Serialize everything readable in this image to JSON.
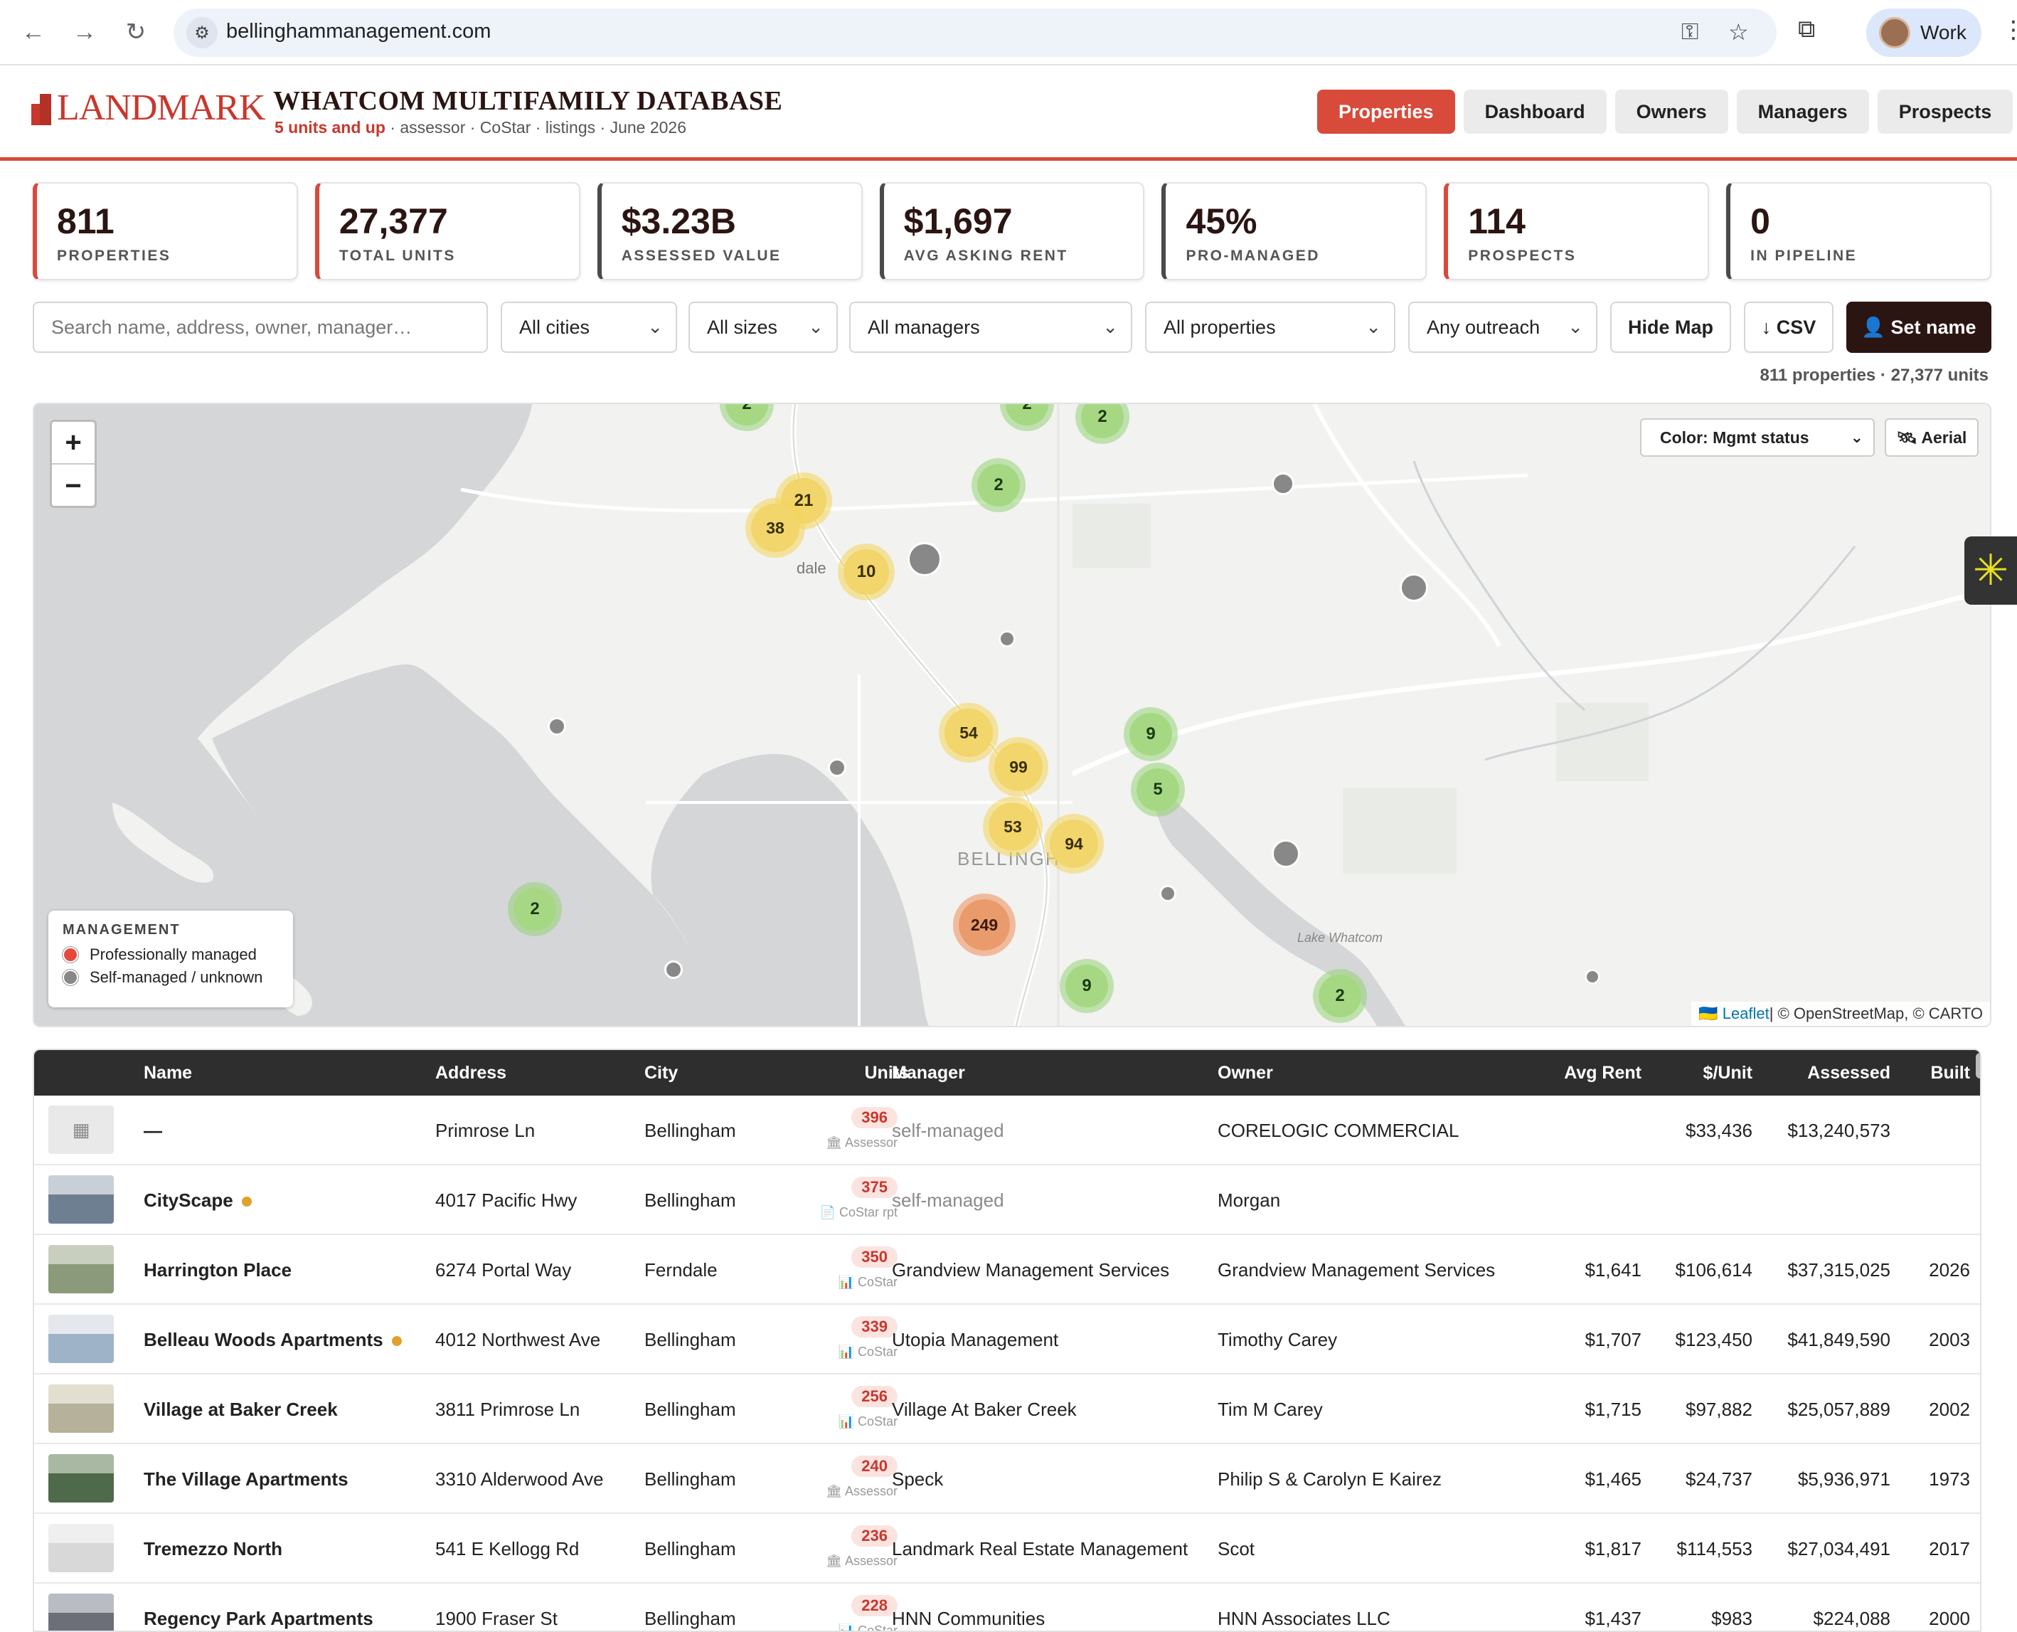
{
  "browser": {
    "url": "bellinghammanagement.com",
    "profile_label": "Work",
    "back_icon": "←",
    "forward_icon": "→",
    "reload_icon": "↻"
  },
  "header": {
    "logo_text": "LANDMARK",
    "title": "WHATCOM MULTIFAMILY DATABASE",
    "subtitle_accent": "5 units and up",
    "subtitle_rest": " · assessor · CoStar · listings · June 2026",
    "tabs": [
      "Properties",
      "Dashboard",
      "Owners",
      "Managers",
      "Prospects"
    ],
    "active_tab": "Properties"
  },
  "stats": [
    {
      "value": "811",
      "label": "PROPERTIES"
    },
    {
      "value": "27,377",
      "label": "TOTAL UNITS"
    },
    {
      "value": "$3.23B",
      "label": "ASSESSED VALUE"
    },
    {
      "value": "$1,697",
      "label": "AVG ASKING RENT"
    },
    {
      "value": "45%",
      "label": "PRO-MANAGED"
    },
    {
      "value": "114",
      "label": "PROSPECTS"
    },
    {
      "value": "0",
      "label": "IN PIPELINE"
    }
  ],
  "filters": {
    "search_placeholder": "Search name, address, owner, manager…",
    "city": "All cities",
    "size": "All sizes",
    "manager": "All managers",
    "properties": "All properties",
    "outreach": "Any outreach",
    "hide_map": "Hide Map",
    "csv": "↓ CSV",
    "set_name": "👤 Set name"
  },
  "count_line": "811 properties · 27,377 units",
  "map": {
    "zoom_in": "+",
    "zoom_out": "−",
    "color_select": "Color: Mgmt status",
    "aerial_label": "🛰 Aerial",
    "place_labels": [
      "dale",
      "BELLINGH",
      "Lake Whatcom"
    ],
    "clusters": [
      {
        "count": "2",
        "color": "green"
      },
      {
        "count": "2",
        "color": "green"
      },
      {
        "count": "2",
        "color": "green"
      },
      {
        "count": "2",
        "color": "green"
      },
      {
        "count": "21",
        "color": "yellow"
      },
      {
        "count": "38",
        "color": "yellow"
      },
      {
        "count": "10",
        "color": "yellow"
      },
      {
        "count": "54",
        "color": "yellow"
      },
      {
        "count": "99",
        "color": "yellow"
      },
      {
        "count": "9",
        "color": "green"
      },
      {
        "count": "5",
        "color": "green"
      },
      {
        "count": "53",
        "color": "yellow"
      },
      {
        "count": "94",
        "color": "yellow"
      },
      {
        "count": "2",
        "color": "green"
      },
      {
        "count": "249",
        "color": "orange"
      },
      {
        "count": "9",
        "color": "green"
      },
      {
        "count": "2",
        "color": "green"
      }
    ],
    "legend_title": "MANAGEMENT",
    "legend_items": [
      {
        "label": "Professionally managed",
        "color": "#e8483a"
      },
      {
        "label": "Self-managed / unknown",
        "color": "#888888"
      }
    ],
    "attribution_link": "Leaflet",
    "attribution_rest": " | © OpenStreetMap, © CARTO"
  },
  "table": {
    "columns": [
      "Name",
      "Address",
      "City",
      "Units",
      "Manager",
      "Owner",
      "Avg Rent",
      "$/Unit",
      "Assessed",
      "Built"
    ],
    "rows": [
      {
        "name": "—",
        "dot": false,
        "address": "Primrose Ln",
        "city": "Bellingham",
        "units": "396",
        "source": "🏛 Assessor",
        "manager": "self-managed",
        "manager_muted": true,
        "owner": "CORELOGIC COMMERCIAL",
        "avg_rent": "",
        "per_unit": "$33,436",
        "assessed": "$13,240,573",
        "built": ""
      },
      {
        "name": "CityScape",
        "dot": true,
        "address": "4017 Pacific Hwy",
        "city": "Bellingham",
        "units": "375",
        "source": "📄 CoStar rpt",
        "manager": "self-managed",
        "manager_muted": true,
        "owner": "Morgan",
        "avg_rent": "",
        "per_unit": "",
        "assessed": "",
        "built": ""
      },
      {
        "name": "Harrington Place",
        "dot": false,
        "address": "6274 Portal Way",
        "city": "Ferndale",
        "units": "350",
        "source": "📊 CoStar",
        "manager": "Grandview Management Services",
        "manager_muted": false,
        "owner": "Grandview Management Services",
        "avg_rent": "$1,641",
        "per_unit": "$106,614",
        "assessed": "$37,315,025",
        "built": "2026"
      },
      {
        "name": "Belleau Woods Apartments",
        "dot": true,
        "address": "4012 Northwest Ave",
        "city": "Bellingham",
        "units": "339",
        "source": "📊 CoStar",
        "manager": "Utopia Management",
        "manager_muted": false,
        "owner": "Timothy Carey",
        "avg_rent": "$1,707",
        "per_unit": "$123,450",
        "assessed": "$41,849,590",
        "built": "2003"
      },
      {
        "name": "Village at Baker Creek",
        "dot": false,
        "address": "3811 Primrose Ln",
        "city": "Bellingham",
        "units": "256",
        "source": "📊 CoStar",
        "manager": "Village At Baker Creek",
        "manager_muted": false,
        "owner": "Tim M Carey",
        "avg_rent": "$1,715",
        "per_unit": "$97,882",
        "assessed": "$25,057,889",
        "built": "2002"
      },
      {
        "name": "The Village Apartments",
        "dot": false,
        "address": "3310 Alderwood Ave",
        "city": "Bellingham",
        "units": "240",
        "source": "🏛 Assessor",
        "manager": "Speck",
        "manager_muted": false,
        "owner": "Philip S & Carolyn E Kairez",
        "avg_rent": "$1,465",
        "per_unit": "$24,737",
        "assessed": "$5,936,971",
        "built": "1973"
      },
      {
        "name": "Tremezzo North",
        "dot": false,
        "address": "541 E Kellogg Rd",
        "city": "Bellingham",
        "units": "236",
        "source": "🏛 Assessor",
        "manager": "Landmark Real Estate Management",
        "manager_muted": false,
        "owner": "Scot",
        "avg_rent": "$1,817",
        "per_unit": "$114,553",
        "assessed": "$27,034,491",
        "built": "2017"
      },
      {
        "name": "Regency Park Apartments",
        "dot": false,
        "address": "1900 Fraser St",
        "city": "Bellingham",
        "units": "228",
        "source": "📊 CoStar",
        "manager": "HNN Communities",
        "manager_muted": false,
        "owner": "HNN Associates LLC",
        "avg_rent": "$1,437",
        "per_unit": "$983",
        "assessed": "$224,088",
        "built": "2000"
      }
    ]
  }
}
